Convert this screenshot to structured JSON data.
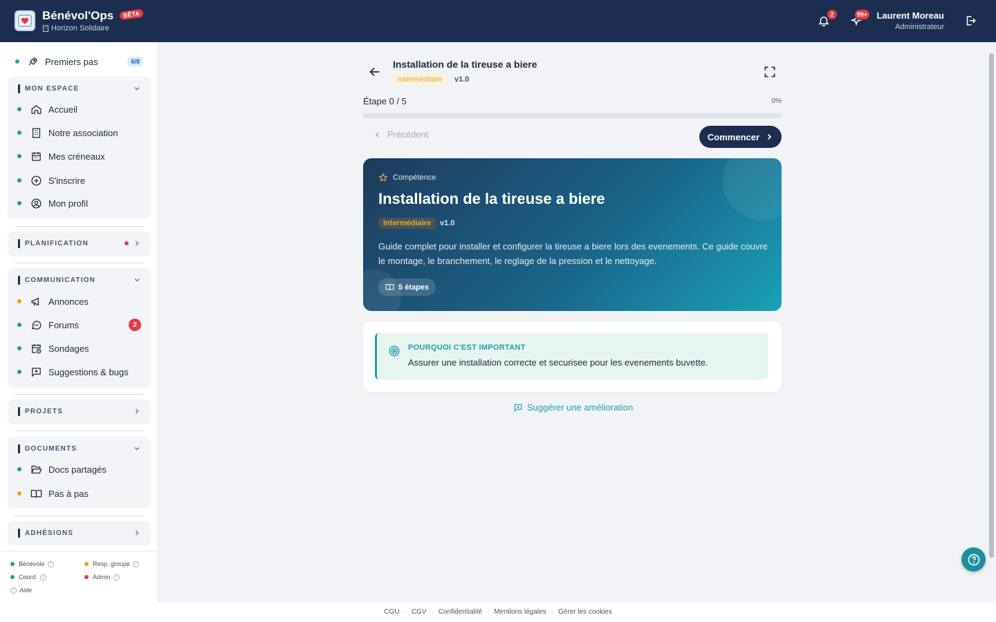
{
  "app": {
    "name": "Bénévol'Ops",
    "badge": "BÊTA",
    "org": "Horizon Solidaire"
  },
  "header": {
    "notifications_count": "2",
    "activity_count": "99+",
    "user_name": "Laurent Moreau",
    "user_role": "Administrateur"
  },
  "sidebar": {
    "first_steps": {
      "label": "Premiers pas",
      "count": "6/8"
    },
    "mon_espace": {
      "title": "MON ESPACE",
      "items": [
        {
          "label": "Accueil",
          "icon": "home-icon"
        },
        {
          "label": "Notre association",
          "icon": "building-icon"
        },
        {
          "label": "Mes créneaux",
          "icon": "calendar-icon"
        },
        {
          "label": "S'inscrire",
          "icon": "plus-circle-icon"
        },
        {
          "label": "Mon profil",
          "icon": "user-circle-icon"
        }
      ]
    },
    "planification": {
      "title": "PLANIFICATION"
    },
    "communication": {
      "title": "COMMUNICATION",
      "items": [
        {
          "label": "Annonces",
          "icon": "megaphone-icon"
        },
        {
          "label": "Forums",
          "icon": "chat-icon",
          "badge": "2"
        },
        {
          "label": "Sondages",
          "icon": "calendar-clock-icon"
        },
        {
          "label": "Suggestions & bugs",
          "icon": "message-plus-icon"
        }
      ]
    },
    "projets": {
      "title": "PROJETS"
    },
    "documents": {
      "title": "DOCUMENTS",
      "items": [
        {
          "label": "Docs partagés",
          "icon": "folder-open-icon"
        },
        {
          "label": "Pas à pas",
          "icon": "book-open-icon"
        }
      ]
    },
    "adhesions": {
      "title": "ADHÉSIONS"
    },
    "legend": {
      "benevole": "Bénévole",
      "resp_groupe": "Resp. groupe",
      "coord": "Coord.",
      "admin": "Admin",
      "aide": "Aide"
    }
  },
  "guide": {
    "title": "Installation de la tireuse a biere",
    "level": "Intermédiaire",
    "version": "v1.0",
    "step_label": "Étape 0 / 5",
    "progress_percent": 0,
    "progress_text": "0%",
    "prev_label": "Précédent",
    "start_label": "Commencer",
    "kind": "Compétence",
    "description": "Guide complet pour installer et configurer la tireuse a biere lors des evenements. Ce guide couvre le montage, le branchement, le reglage de la pression et le nettoyage.",
    "steps_count": "5 étapes",
    "why_title": "POURQUOI C'EST IMPORTANT",
    "why_text": "Assurer une installation correcte et securisee pour les evenements buvette.",
    "suggest_label": "Suggérer une amélioration"
  },
  "footer": {
    "links": [
      "CGU",
      "CGV",
      "Confidentialité",
      "Mentions légales",
      "Gérer les cookies"
    ]
  },
  "colors": {
    "navy": "#1c2d4f",
    "teal": "#1e9db4",
    "red": "#e53946",
    "green": "#22a55a",
    "orange": "#f59e0b"
  }
}
